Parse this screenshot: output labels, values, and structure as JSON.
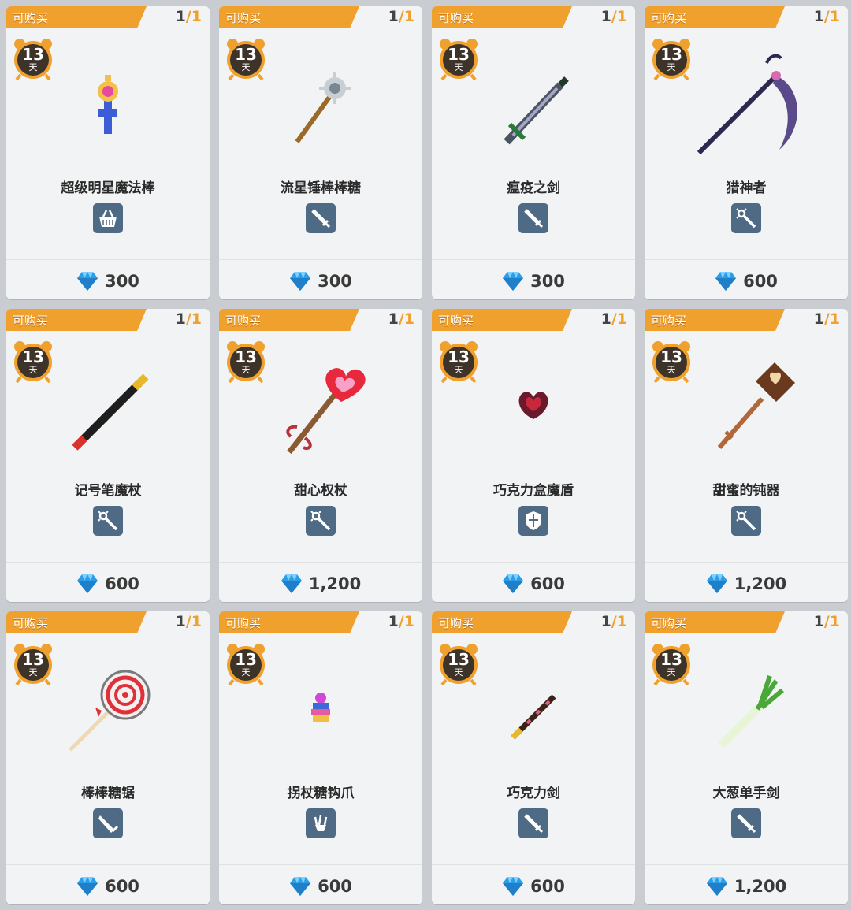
{
  "colors": {
    "banner": "#f0a02c",
    "type_tile": "#4f6a85",
    "card": "#f2f3f4",
    "gem": "#2a9ee8"
  },
  "items": [
    {
      "badge": "可购买",
      "count": "1",
      "slash": "/",
      "total": "1",
      "days": "13",
      "unit": "天",
      "name": "超级明星魔法棒",
      "type_icon": "basket-icon",
      "price": "300"
    },
    {
      "badge": "可购买",
      "count": "1",
      "slash": "/",
      "total": "1",
      "days": "13",
      "unit": "天",
      "name": "流星锤棒棒糖",
      "type_icon": "sword-icon",
      "price": "300"
    },
    {
      "badge": "可购买",
      "count": "1",
      "slash": "/",
      "total": "1",
      "days": "13",
      "unit": "天",
      "name": "瘟疫之剑",
      "type_icon": "sword-icon",
      "price": "300"
    },
    {
      "badge": "可购买",
      "count": "1",
      "slash": "/",
      "total": "1",
      "days": "13",
      "unit": "天",
      "name": "猎神者",
      "type_icon": "staff-icon",
      "price": "600"
    },
    {
      "badge": "可购买",
      "count": "1",
      "slash": "/",
      "total": "1",
      "days": "13",
      "unit": "天",
      "name": "记号笔魔杖",
      "type_icon": "staff-icon",
      "price": "600"
    },
    {
      "badge": "可购买",
      "count": "1",
      "slash": "/",
      "total": "1",
      "days": "13",
      "unit": "天",
      "name": "甜心权杖",
      "type_icon": "staff-icon",
      "price": "1,200"
    },
    {
      "badge": "可购买",
      "count": "1",
      "slash": "/",
      "total": "1",
      "days": "13",
      "unit": "天",
      "name": "巧克力盒魔盾",
      "type_icon": "shield-icon",
      "price": "600"
    },
    {
      "badge": "可购买",
      "count": "1",
      "slash": "/",
      "total": "1",
      "days": "13",
      "unit": "天",
      "name": "甜蜜的钝器",
      "type_icon": "staff-icon",
      "price": "1,200"
    },
    {
      "badge": "可购买",
      "count": "1",
      "slash": "/",
      "total": "1",
      "days": "13",
      "unit": "天",
      "name": "棒棒糖锯",
      "type_icon": "blade-icon",
      "price": "600"
    },
    {
      "badge": "可购买",
      "count": "1",
      "slash": "/",
      "total": "1",
      "days": "13",
      "unit": "天",
      "name": "拐杖糖钩爪",
      "type_icon": "claw-icon",
      "price": "600"
    },
    {
      "badge": "可购买",
      "count": "1",
      "slash": "/",
      "total": "1",
      "days": "13",
      "unit": "天",
      "name": "巧克力剑",
      "type_icon": "sword-icon",
      "price": "600"
    },
    {
      "badge": "可购买",
      "count": "1",
      "slash": "/",
      "total": "1",
      "days": "13",
      "unit": "天",
      "name": "大葱单手剑",
      "type_icon": "sword-icon",
      "price": "1,200"
    }
  ]
}
